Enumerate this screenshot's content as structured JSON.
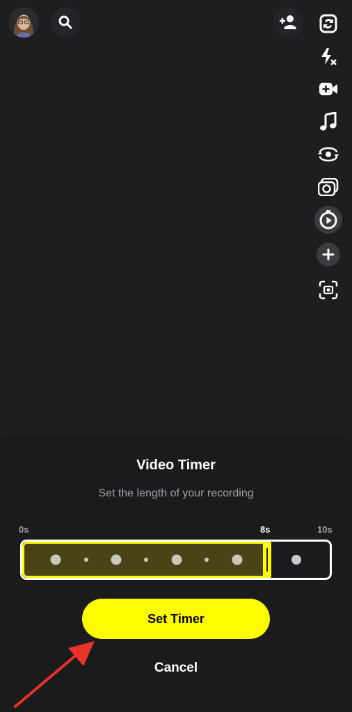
{
  "camera": {
    "top_icons": [
      "avatar",
      "search-icon",
      "add-friend-icon"
    ],
    "right_rail": [
      {
        "name": "flip-camera-icon"
      },
      {
        "name": "flash-off-icon"
      },
      {
        "name": "video-chat-icon"
      },
      {
        "name": "music-icon"
      },
      {
        "name": "dual-camera-icon"
      },
      {
        "name": "multi-snap-icon"
      },
      {
        "name": "timer-icon",
        "active": true
      },
      {
        "name": "more-plus-icon"
      },
      {
        "name": "scan-icon"
      }
    ]
  },
  "timer_sheet": {
    "title": "Video Timer",
    "subtitle": "Set the length of your recording",
    "ticks": {
      "min": "0s",
      "selected": "8s",
      "max": "10s"
    },
    "selected_seconds": 8,
    "max_seconds": 10,
    "set_button": "Set Timer",
    "cancel_button": "Cancel"
  },
  "colors": {
    "accent": "#fffc00",
    "arrow": "#e8322a",
    "background": "#1d1e20"
  }
}
